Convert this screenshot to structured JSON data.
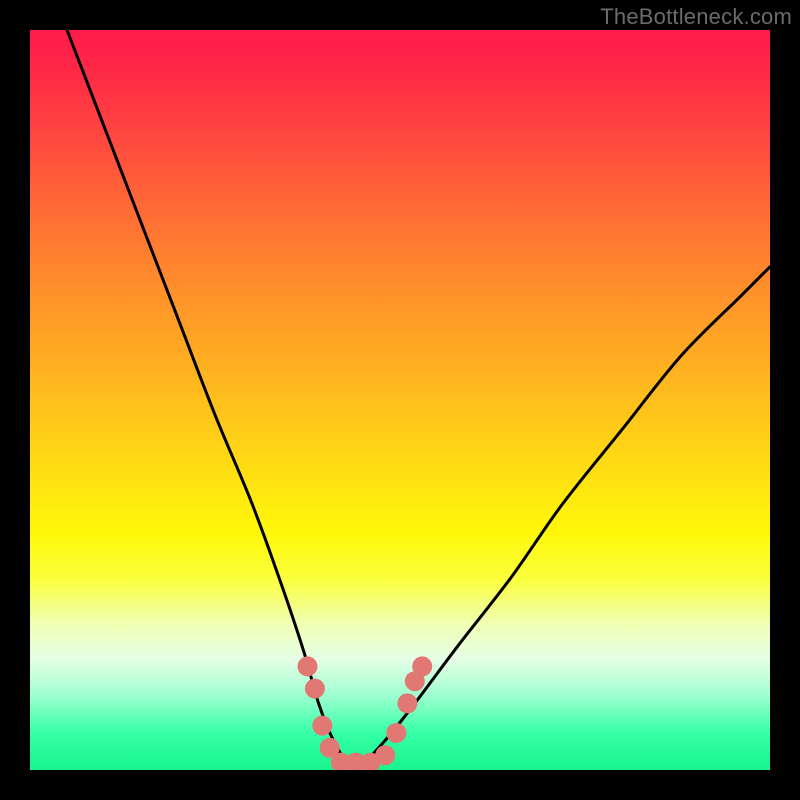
{
  "watermark": "TheBottleneck.com",
  "chart_data": {
    "type": "line",
    "title": "",
    "xlabel": "",
    "ylabel": "",
    "xlim": [
      0,
      100
    ],
    "ylim": [
      0,
      100
    ],
    "grid": false,
    "legend": false,
    "series": [
      {
        "name": "bottleneck-curve",
        "x": [
          5,
          10,
          15,
          20,
          25,
          30,
          34,
          37,
          39,
          41,
          43,
          45,
          48,
          52,
          58,
          65,
          72,
          80,
          88,
          96,
          100
        ],
        "y": [
          100,
          87,
          74,
          61,
          48,
          36,
          25,
          16,
          9,
          4,
          1,
          1,
          4,
          9,
          17,
          26,
          36,
          46,
          56,
          64,
          68
        ]
      }
    ],
    "markers": {
      "name": "highlight-dots",
      "color": "#e17874",
      "points": [
        {
          "x": 37.5,
          "y": 14
        },
        {
          "x": 38.5,
          "y": 11
        },
        {
          "x": 39.5,
          "y": 6
        },
        {
          "x": 40.5,
          "y": 3
        },
        {
          "x": 42.0,
          "y": 1
        },
        {
          "x": 44.0,
          "y": 1
        },
        {
          "x": 46.0,
          "y": 1
        },
        {
          "x": 48.0,
          "y": 2
        },
        {
          "x": 49.5,
          "y": 5
        },
        {
          "x": 51.0,
          "y": 9
        },
        {
          "x": 52.0,
          "y": 12
        },
        {
          "x": 53.0,
          "y": 14
        }
      ]
    },
    "background": {
      "type": "vertical-gradient",
      "stops": [
        {
          "pct": 0,
          "color": "#ff1a4b"
        },
        {
          "pct": 34,
          "color": "#ff8c2c"
        },
        {
          "pct": 68,
          "color": "#fff80a"
        },
        {
          "pct": 90,
          "color": "#9dffd0"
        },
        {
          "pct": 100,
          "color": "#18f58c"
        }
      ]
    }
  }
}
